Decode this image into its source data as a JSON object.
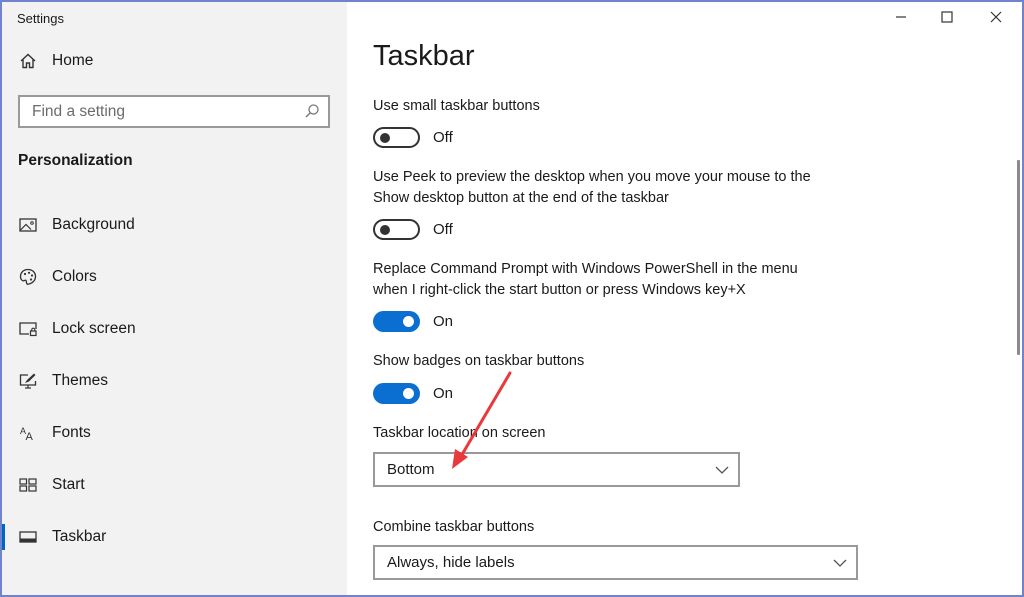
{
  "window": {
    "title": "Settings",
    "controls": {
      "minimize": "minimize-icon",
      "maximize": "maximize-icon",
      "close": "close-icon"
    }
  },
  "sidebar": {
    "home": {
      "label": "Home",
      "icon": "home-icon"
    },
    "search": {
      "placeholder": "Find a setting",
      "value": "",
      "icon": "search-icon"
    },
    "section": "Personalization",
    "items": [
      {
        "label": "Background",
        "icon": "picture-icon",
        "selected": false
      },
      {
        "label": "Colors",
        "icon": "palette-icon",
        "selected": false
      },
      {
        "label": "Lock screen",
        "icon": "lock-screen-icon",
        "selected": false
      },
      {
        "label": "Themes",
        "icon": "themes-icon",
        "selected": false
      },
      {
        "label": "Fonts",
        "icon": "fonts-icon",
        "selected": false
      },
      {
        "label": "Start",
        "icon": "start-icon",
        "selected": false
      },
      {
        "label": "Taskbar",
        "icon": "taskbar-icon",
        "selected": true
      }
    ]
  },
  "main": {
    "title": "Taskbar",
    "settings": [
      {
        "label": "Use small taskbar buttons",
        "state": "Off",
        "on": false
      },
      {
        "label_line1": "Use Peek to preview the desktop when you move your mouse to the",
        "label_line2": "Show desktop button at the end of the taskbar",
        "state": "Off",
        "on": false
      },
      {
        "label_line1": "Replace Command Prompt with Windows PowerShell in the menu",
        "label_line2": "when I right-click the start button or press Windows key+X",
        "state": "On",
        "on": true
      },
      {
        "label": "Show badges on taskbar buttons",
        "state": "On",
        "on": true
      }
    ],
    "dropdowns": [
      {
        "label": "Taskbar location on screen",
        "value": "Bottom"
      },
      {
        "label": "Combine taskbar buttons",
        "value": "Always, hide labels"
      }
    ]
  },
  "annotation": {
    "type": "arrow",
    "color": "#e8393b",
    "points_to": "taskbar-location-dropdown"
  },
  "colors": {
    "accent": "#0a6fd0",
    "sidebar_bg": "#f2f2f2",
    "content_bg": "#ffffff",
    "frame": "#6f83cf"
  }
}
